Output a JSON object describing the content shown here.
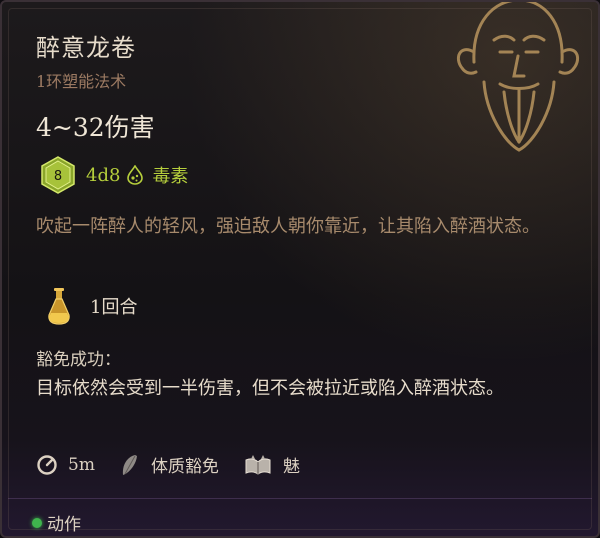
{
  "spell": {
    "title": "醉意龙卷",
    "subtitle": "1环塑能法术",
    "damage": "4~32伤害",
    "dice_icon_value": "8",
    "dice": "4d8",
    "damage_type": "毒素",
    "description": "吹起一阵醉人的轻风，强迫敌人朝你靠近，让其陷入醉酒状态。",
    "cost": "1回合",
    "save_title": "豁免成功：",
    "save_description": "目标依然会受到一半伤害，但不会被拉近或陷入醉酒状态。",
    "range": "5m",
    "save_type": "体质豁免",
    "spell_ability": "魅",
    "action_label": "动作"
  },
  "colors": {
    "damage_type": "#b6cf3c",
    "action_dot": "#3fb44d"
  },
  "icons": {
    "portrait": "bald-monk-portrait-icon",
    "dice": "d8-dice-icon",
    "damage_type": "poison-drop-icon",
    "cost": "flask-icon",
    "range": "range-gauge-icon",
    "save": "feather-icon",
    "ability": "book-icon",
    "action": "green-dot-icon"
  }
}
